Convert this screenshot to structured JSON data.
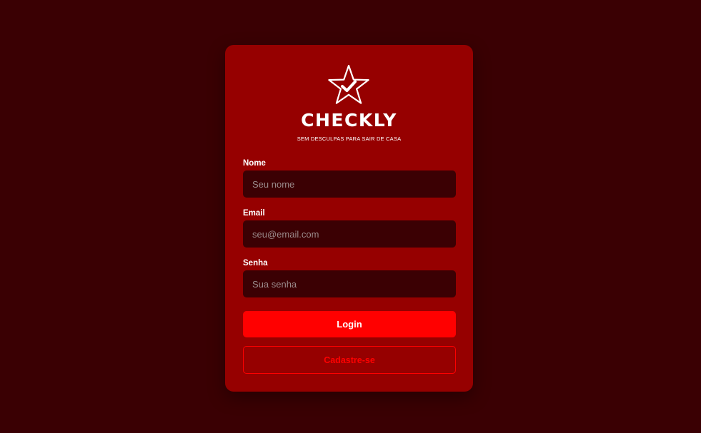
{
  "brand": {
    "name": "CHECKLY",
    "tagline": "SEM DESCULPAS PARA SAIR DE CASA",
    "icon": "star-check-icon"
  },
  "form": {
    "name_label": "Nome",
    "name_placeholder": "Seu nome",
    "email_label": "Email",
    "email_placeholder": "seu@email.com",
    "password_label": "Senha",
    "password_placeholder": "Sua senha"
  },
  "actions": {
    "login_label": "Login",
    "register_label": "Cadastre-se"
  },
  "colors": {
    "background": "#3a0003",
    "card": "#960000",
    "input": "#3b0003",
    "accent": "#ff0000",
    "text": "#ffffff"
  }
}
